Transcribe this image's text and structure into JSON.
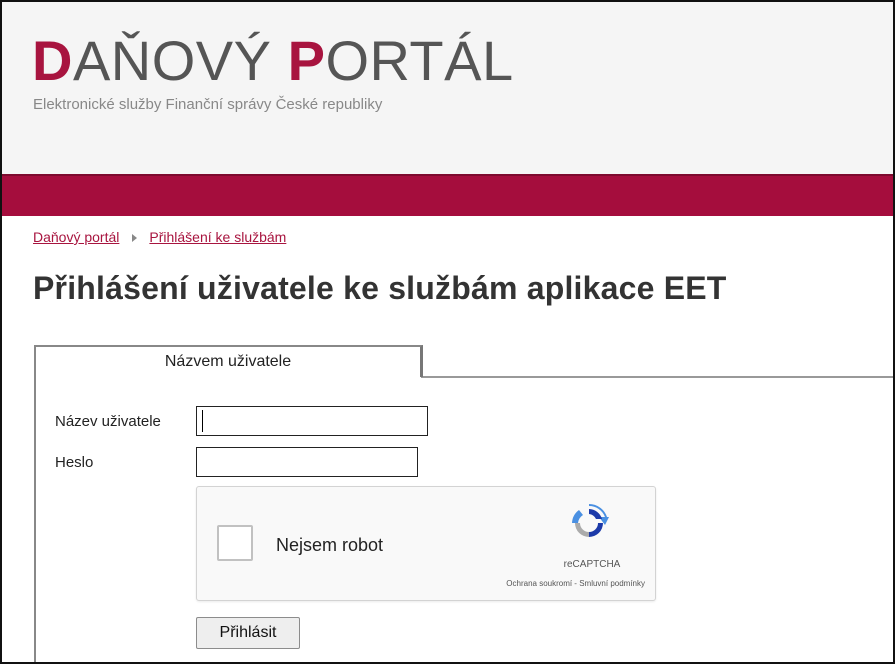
{
  "header": {
    "logo_accent_1": "D",
    "logo_rest_1": "AŇOVÝ ",
    "logo_accent_2": "P",
    "logo_rest_2": "ORTÁL",
    "tagline": "Elektronické služby Finanční správy České republiky"
  },
  "colors": {
    "brand": "#a8143f",
    "bar": "#a50d3d"
  },
  "breadcrumb": {
    "items": [
      "Daňový portál",
      "Přihlášení ke službám"
    ],
    "separator_icon": "triangle-right-icon"
  },
  "page_title": "Přihlášení uživatele ke službám aplikace EET",
  "tabs": [
    {
      "label": "Názvem uživatele",
      "active": true
    }
  ],
  "form": {
    "username_label": "Název uživatele",
    "username_value": "",
    "password_label": "Heslo",
    "password_value": "",
    "submit_label": "Přihlásit"
  },
  "captcha": {
    "checkbox_label": "Nejsem robot",
    "brand": "reCAPTCHA",
    "links": "Ochrana soukromí - Smluvní podmínky",
    "icon": "recaptcha-logo-icon"
  }
}
